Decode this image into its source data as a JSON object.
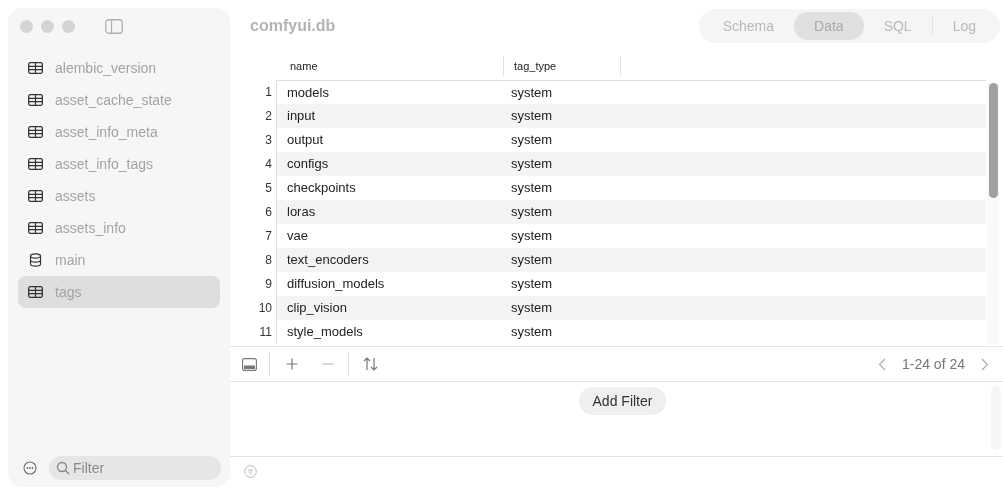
{
  "window": {
    "title": "comfyui.db"
  },
  "tabs": [
    {
      "label": "Schema",
      "selected": false
    },
    {
      "label": "Data",
      "selected": true
    },
    {
      "label": "SQL",
      "selected": false
    },
    {
      "label": "Log",
      "selected": false
    }
  ],
  "sidebar": {
    "items": [
      {
        "label": "alembic_version",
        "kind": "table",
        "selected": false
      },
      {
        "label": "asset_cache_state",
        "kind": "table",
        "selected": false
      },
      {
        "label": "asset_info_meta",
        "kind": "table",
        "selected": false
      },
      {
        "label": "asset_info_tags",
        "kind": "table",
        "selected": false
      },
      {
        "label": "assets",
        "kind": "table",
        "selected": false
      },
      {
        "label": "assets_info",
        "kind": "table",
        "selected": false
      },
      {
        "label": "main",
        "kind": "database",
        "selected": false
      },
      {
        "label": "tags",
        "kind": "table",
        "selected": true
      }
    ],
    "filter": {
      "placeholder": "Filter"
    }
  },
  "table": {
    "columns": [
      "name",
      "tag_type"
    ],
    "rows": [
      {
        "number": "1",
        "cells": [
          "models",
          "system"
        ]
      },
      {
        "number": "2",
        "cells": [
          "input",
          "system"
        ]
      },
      {
        "number": "3",
        "cells": [
          "output",
          "system"
        ]
      },
      {
        "number": "4",
        "cells": [
          "configs",
          "system"
        ]
      },
      {
        "number": "5",
        "cells": [
          "checkpoints",
          "system"
        ]
      },
      {
        "number": "6",
        "cells": [
          "loras",
          "system"
        ]
      },
      {
        "number": "7",
        "cells": [
          "vae",
          "system"
        ]
      },
      {
        "number": "8",
        "cells": [
          "text_encoders",
          "system"
        ]
      },
      {
        "number": "9",
        "cells": [
          "diffusion_models",
          "system"
        ]
      },
      {
        "number": "10",
        "cells": [
          "clip_vision",
          "system"
        ]
      },
      {
        "number": "11",
        "cells": [
          "style_models",
          "system"
        ]
      }
    ]
  },
  "pagination": {
    "range": "1-24 of 24"
  },
  "filter_panel": {
    "add_button": "Add Filter"
  }
}
